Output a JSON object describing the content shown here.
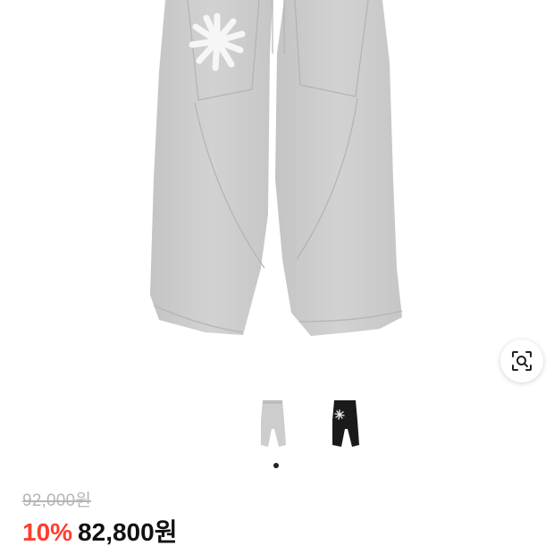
{
  "product": {
    "image_alt": "",
    "thumbnails": [
      {
        "name": "gray-variant"
      },
      {
        "name": "black-variant"
      }
    ],
    "active_dot_index": 0
  },
  "pricing": {
    "original_price": "92,000원",
    "discount_rate": "10%",
    "sale_price": "82,800원"
  },
  "icons": {
    "lens": "image-search-icon"
  },
  "colors": {
    "discount": "#ff3d2e",
    "pants_gray": "#c9c9c9",
    "pants_black": "#1a1a1a",
    "flower_logo": "#f6f6f6"
  }
}
